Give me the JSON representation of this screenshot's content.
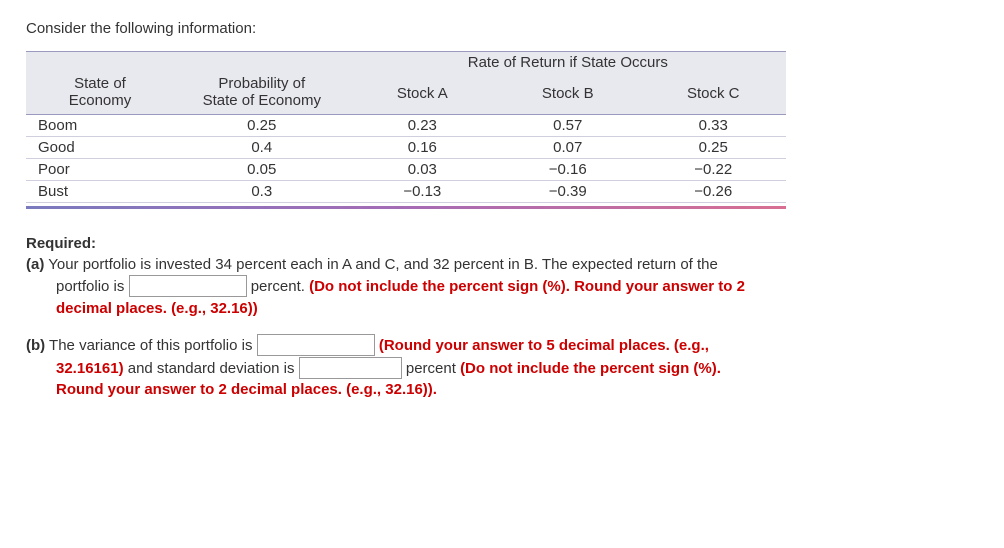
{
  "intro": "Consider the following information:",
  "table": {
    "spanHeader": "Rate of Return if State Occurs",
    "headers": {
      "state": "State of\nEconomy",
      "prob": "Probability of\nState of Economy",
      "a": "Stock A",
      "b": "Stock B",
      "c": "Stock C"
    },
    "rows": [
      {
        "state": "Boom",
        "prob": "0.25",
        "a": "0.23",
        "b": "0.57",
        "c": "0.33"
      },
      {
        "state": "Good",
        "prob": "0.4",
        "a": "0.16",
        "b": "0.07",
        "c": "0.25"
      },
      {
        "state": "Poor",
        "prob": "0.05",
        "a": "0.03",
        "b": "−0.16",
        "c": "−0.22"
      },
      {
        "state": "Bust",
        "prob": "0.3",
        "a": "−0.13",
        "b": "−0.39",
        "c": "−0.26"
      }
    ]
  },
  "required": "Required:",
  "partA": {
    "label": "(a)",
    "text1": " Your portfolio is invested 34 percent each in A and C, and 32 percent in B. The expected return of the",
    "text2_a": "portfolio is ",
    "text2_b": " percent. ",
    "red1": "(Do not include the percent sign (%). Round your answer to 2",
    "red2": "decimal places. (e.g., 32.16))"
  },
  "partB": {
    "label": "(b)",
    "text1": " The variance of this portfolio is ",
    "red1": " (Round your answer to 5 decimal places. (e.g.,",
    "red2a": "32.16161)",
    "text2": " and standard deviation is ",
    "text3": " percent ",
    "red3": "(Do not include the percent sign (%).",
    "red4": "Round your answer to 2 decimal places. (e.g., 32.16))."
  }
}
